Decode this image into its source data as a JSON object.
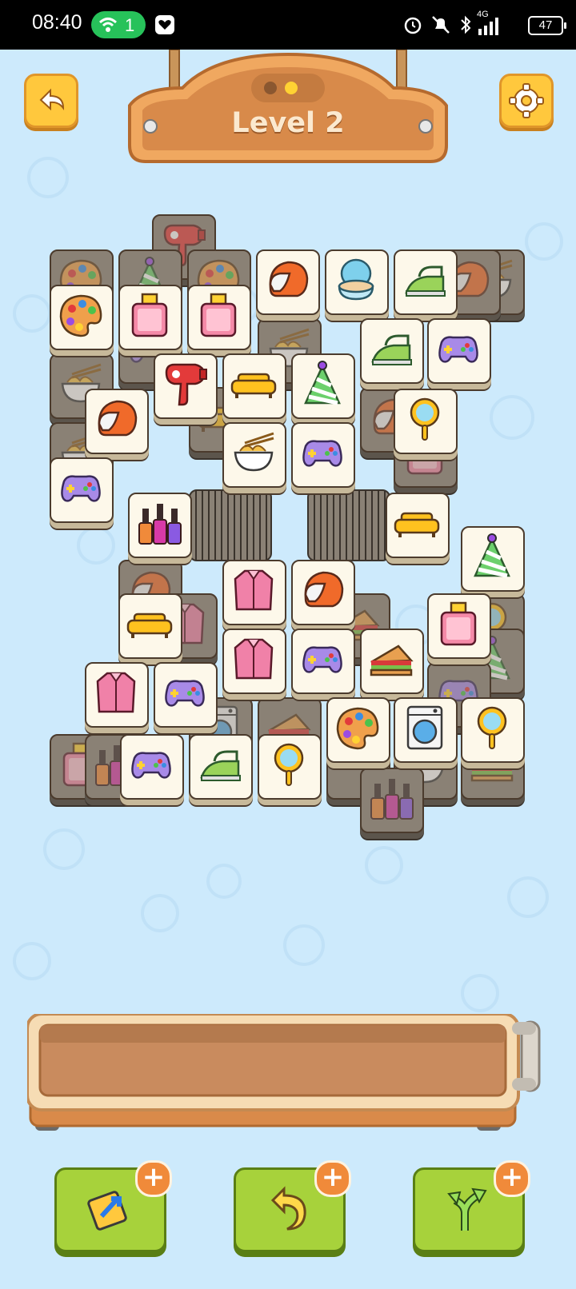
{
  "status_bar": {
    "time": "08:40",
    "hotspot_count": "1",
    "network": "4G",
    "battery": "47"
  },
  "header": {
    "level_label": "Level 2"
  },
  "icons": {
    "back": "back-arrow-icon",
    "settings": "gear-icon"
  },
  "powerups": [
    {
      "name": "shuffle",
      "icon": "shuffle-card-icon",
      "badge": "+"
    },
    {
      "name": "undo",
      "icon": "undo-arrow-icon",
      "badge": "+"
    },
    {
      "name": "hint",
      "icon": "split-arrows-icon",
      "badge": "+"
    }
  ],
  "tile_items": [
    "palette",
    "party-hat",
    "hair-dryer",
    "helmet",
    "compact-mirror",
    "iron",
    "perfume",
    "gamepad",
    "sofa",
    "noodle-bowl",
    "hand-mirror",
    "nail-polish",
    "jacket",
    "sandwich",
    "washing-machine"
  ],
  "colors": {
    "background": "#cdeafc",
    "tile_face": "#fdf8ea",
    "tile_dark": "#8a8175",
    "button_yellow": "#ffc83d",
    "powerup_green": "#a7d23b",
    "plus_badge": "#f08a3a"
  }
}
